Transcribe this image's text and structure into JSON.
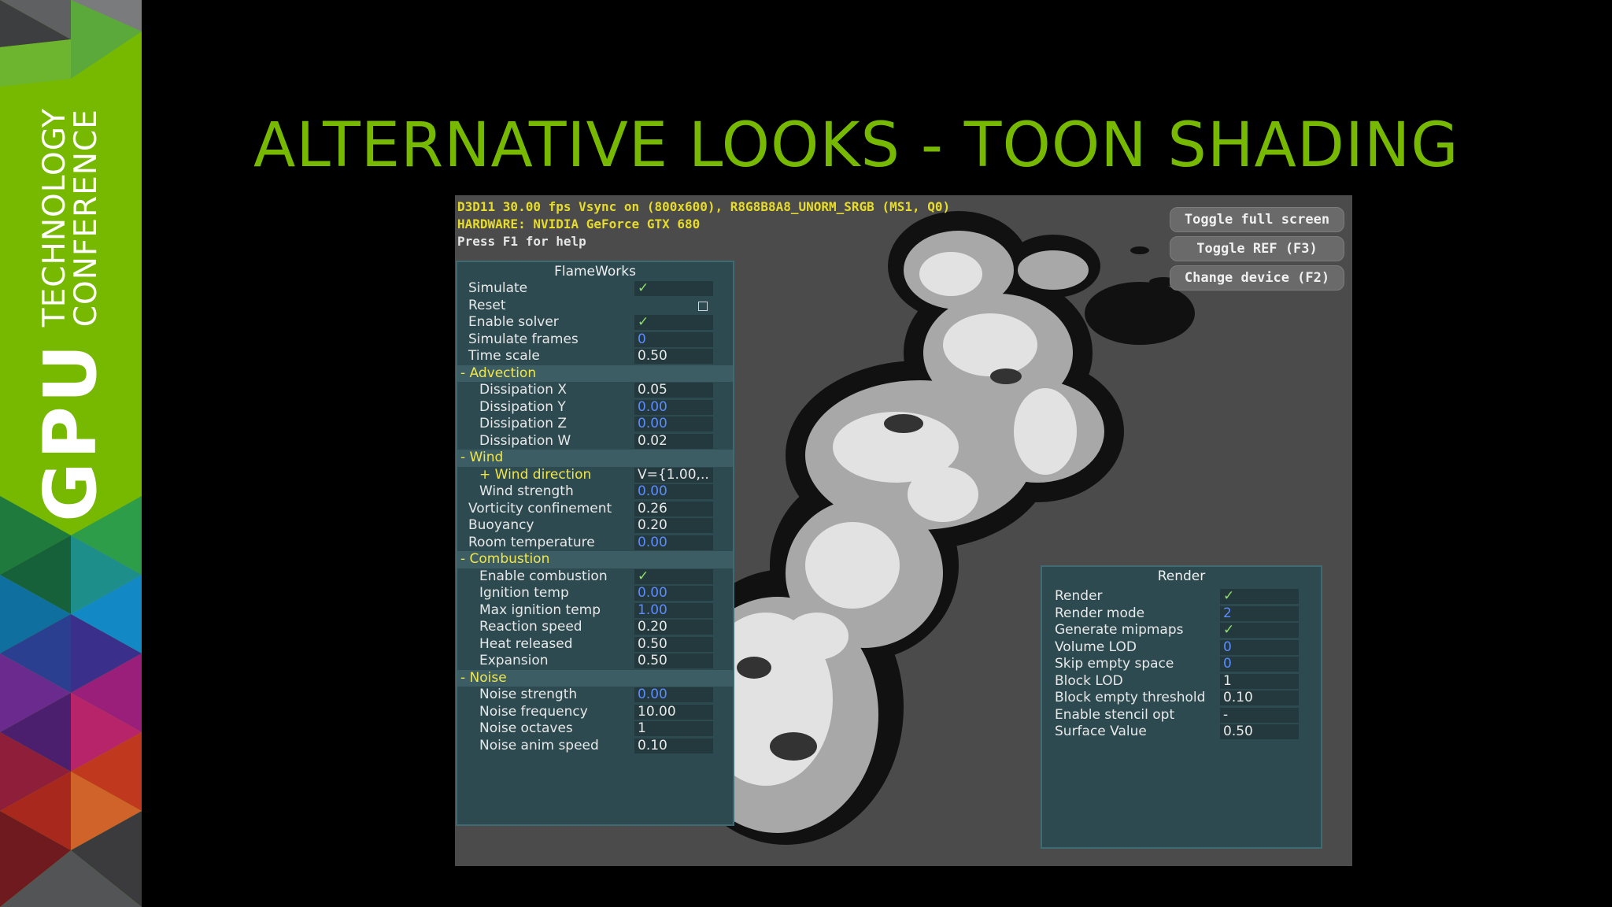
{
  "banner": {
    "brand_main": "GPU",
    "brand_line1": "TECHNOLOGY",
    "brand_line2": "CONFERENCE"
  },
  "slide": {
    "title": "ALTERNATIVE LOOKS - TOON SHADING"
  },
  "hud": {
    "line1": "D3D11 30.00 fps Vsync on (800x600), R8G8B8A8_UNORM_SRGB (MS1, Q0)",
    "line2": "HARDWARE: NVIDIA GeForce GTX 680",
    "line3": "Press F1 for help"
  },
  "buttons": {
    "fullscreen": "Toggle full screen",
    "ref": "Toggle REF (F3)",
    "device": "Change device (F2)"
  },
  "flameworks": {
    "title": "FlameWorks",
    "rows": [
      {
        "label": "Simulate",
        "value": "✓",
        "kind": "check",
        "indent": 0
      },
      {
        "label": "Reset",
        "value": "",
        "kind": "box",
        "indent": 0
      },
      {
        "label": "Enable solver",
        "value": "✓",
        "kind": "check",
        "indent": 0
      },
      {
        "label": "Simulate frames",
        "value": "0",
        "kind": "blue",
        "indent": 0
      },
      {
        "label": "Time scale",
        "value": "0.50",
        "kind": "white",
        "indent": 0
      },
      {
        "label": "- Advection",
        "value": "",
        "kind": "section",
        "indent": 0
      },
      {
        "label": "Dissipation X",
        "value": "0.05",
        "kind": "white",
        "indent": 1
      },
      {
        "label": "Dissipation Y",
        "value": "0.00",
        "kind": "blue",
        "indent": 1
      },
      {
        "label": "Dissipation Z",
        "value": "0.00",
        "kind": "blue",
        "indent": 1
      },
      {
        "label": "Dissipation W",
        "value": "0.02",
        "kind": "white",
        "indent": 1
      },
      {
        "label": "- Wind",
        "value": "",
        "kind": "section",
        "indent": 0
      },
      {
        "label": "+ Wind direction",
        "value": "V={1.00,..",
        "kind": "subwhite",
        "indent": 1
      },
      {
        "label": "Wind strength",
        "value": "0.00",
        "kind": "blue",
        "indent": 1
      },
      {
        "label": "Vorticity confinement",
        "value": "0.26",
        "kind": "white",
        "indent": 0
      },
      {
        "label": "Buoyancy",
        "value": "0.20",
        "kind": "white",
        "indent": 0
      },
      {
        "label": "Room temperature",
        "value": "0.00",
        "kind": "blue",
        "indent": 0
      },
      {
        "label": "- Combustion",
        "value": "",
        "kind": "section",
        "indent": 0
      },
      {
        "label": "Enable combustion",
        "value": "✓",
        "kind": "check",
        "indent": 1
      },
      {
        "label": "Ignition temp",
        "value": "0.00",
        "kind": "blue",
        "indent": 1
      },
      {
        "label": "Max ignition temp",
        "value": "1.00",
        "kind": "blue",
        "indent": 1
      },
      {
        "label": "Reaction speed",
        "value": "0.20",
        "kind": "white",
        "indent": 1
      },
      {
        "label": "Heat released",
        "value": "0.50",
        "kind": "white",
        "indent": 1
      },
      {
        "label": "Expansion",
        "value": "0.50",
        "kind": "white",
        "indent": 1
      },
      {
        "label": "- Noise",
        "value": "",
        "kind": "section",
        "indent": 0
      },
      {
        "label": "Noise strength",
        "value": "0.00",
        "kind": "blue",
        "indent": 1
      },
      {
        "label": "Noise frequency",
        "value": "10.00",
        "kind": "white",
        "indent": 1
      },
      {
        "label": "Noise octaves",
        "value": "1",
        "kind": "white",
        "indent": 1
      },
      {
        "label": "Noise anim speed",
        "value": "0.10",
        "kind": "white",
        "indent": 1
      }
    ]
  },
  "render": {
    "title": "Render",
    "rows": [
      {
        "label": "Render",
        "value": "✓",
        "kind": "check"
      },
      {
        "label": "Render mode",
        "value": "2",
        "kind": "blue"
      },
      {
        "label": "Generate mipmaps",
        "value": "✓",
        "kind": "check"
      },
      {
        "label": "Volume LOD",
        "value": "0",
        "kind": "blue"
      },
      {
        "label": "Skip empty space",
        "value": "0",
        "kind": "blue"
      },
      {
        "label": "Block LOD",
        "value": "1",
        "kind": "white"
      },
      {
        "label": "Block empty threshold",
        "value": "0.10",
        "kind": "white"
      },
      {
        "label": "Enable stencil opt",
        "value": "-",
        "kind": "white"
      },
      {
        "label": "Surface Value",
        "value": "0.50",
        "kind": "white"
      }
    ]
  },
  "colors": {
    "title_green": "#76b900",
    "panel_bg": "#2c4a50",
    "section_label": "#f0e64a",
    "value_blue": "#5b8cff",
    "check_green": "#8fe16a",
    "viewport_bg": "#4b4b4b"
  }
}
